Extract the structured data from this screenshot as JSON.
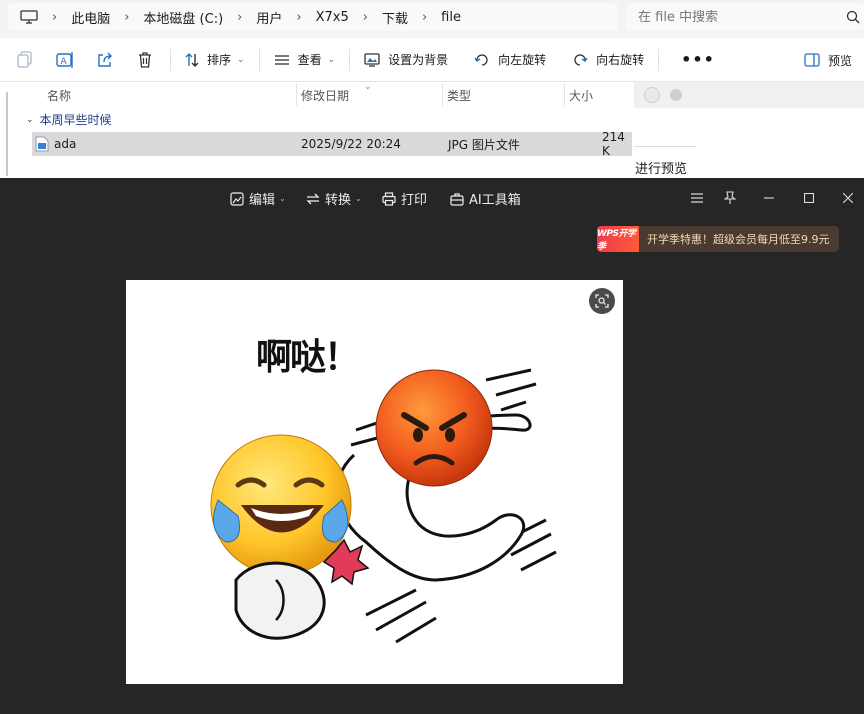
{
  "explorer": {
    "breadcrumb": [
      "此电脑",
      "本地磁盘 (C:)",
      "用户",
      "X7x5",
      "下载",
      "file"
    ],
    "search_placeholder": "在 file 中搜索",
    "toolbar": {
      "sort_label": "排序",
      "view_label": "查看",
      "set_background_label": "设置为背景",
      "rotate_left_label": "向左旋转",
      "rotate_right_label": "向右旋转",
      "more_label": "•••",
      "preview_label": "预览"
    },
    "columns": {
      "name": "名称",
      "date": "修改日期",
      "type": "类型",
      "size": "大小"
    },
    "group_label": "本周早些时候",
    "file": {
      "name": "ada",
      "date": "2025/9/22 20:24",
      "type": "JPG 图片文件",
      "size": "214 K"
    },
    "preview_text": "进行预览"
  },
  "viewer": {
    "tools": {
      "edit": "编辑",
      "convert": "转换",
      "print": "打印",
      "ai_tools": "AI工具箱"
    },
    "promo": {
      "logo": "WPS开学季",
      "text": "开学季特惠！超级会员每月低至9.9元"
    },
    "image": {
      "caption": "啊哒！"
    }
  },
  "icons": {
    "computer": "computer-icon",
    "search": "search-icon",
    "copy": "copy-icon",
    "rename": "rename-icon",
    "share": "share-icon",
    "delete": "trash-icon",
    "sort": "sort-icon",
    "view": "view-icon",
    "set_background": "wallpaper-icon",
    "rotate_left": "rotate-left-icon",
    "rotate_right": "rotate-right-icon",
    "preview": "preview-pane-icon",
    "file": "image-file-icon",
    "edit": "edit-image-icon",
    "convert": "convert-icon",
    "print": "printer-icon",
    "ai": "ai-toolbox-icon",
    "menu": "hamburger-icon",
    "pin": "pin-icon",
    "minimize": "minimize-icon",
    "maximize": "maximize-icon",
    "close": "close-icon",
    "scan": "scan-icon"
  },
  "colors": {
    "viewer_bg": "#262626",
    "selection": "#d9d9d9",
    "group_header": "#1e3a8a",
    "promo_accent": "#f03a4a",
    "promo_text": "#f2d9b8"
  }
}
